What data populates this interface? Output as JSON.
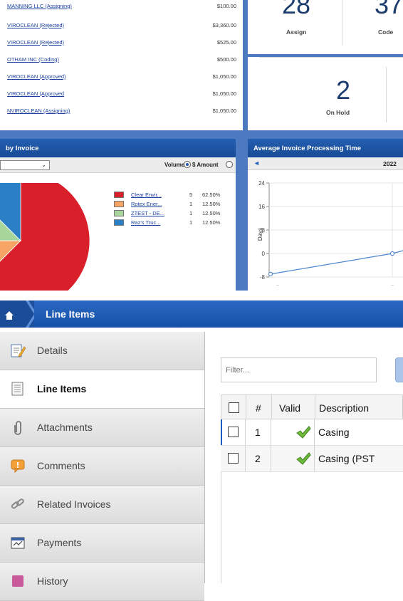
{
  "invoice_list": [
    {
      "name": "MANNING LLC (Assigning)",
      "amount": "$100.00"
    },
    {
      "name": "VIROCLEAN  (Rejected)",
      "amount": "$3,360.00"
    },
    {
      "name": "VIROCLEAN  (Rejected)",
      "amount": "$525.00"
    },
    {
      "name": "OTHAM INC (Coding)",
      "amount": "$500.00"
    },
    {
      "name": "VIROCLEAN  (Approved)",
      "amount": "$1,050.00"
    },
    {
      "name": "VIROCLEAN  (Approved",
      "amount": "$1,050.00"
    },
    {
      "name": "NVIROCLEAN  (Assigning)",
      "amount": "$1,050.00"
    }
  ],
  "stats": {
    "assign": {
      "value": "28",
      "label": "Assign"
    },
    "code": {
      "value": "37",
      "label": "Code"
    },
    "on_hold": {
      "value": "2",
      "label": "On Hold"
    }
  },
  "pie_panel": {
    "title": "by Invoice",
    "volume_label": "Volume",
    "amount_label": "$ Amount",
    "legend": [
      {
        "name": "Clear Envir...",
        "count": "5",
        "pct": "62.50%",
        "color": "#d9202a"
      },
      {
        "name": "Rotex Ener...",
        "count": "1",
        "pct": "12.50%",
        "color": "#f6a566"
      },
      {
        "name": "ZTEST - DE...",
        "count": "1",
        "pct": "12.50%",
        "color": "#a8d59a"
      },
      {
        "name": "Raz's Truc...",
        "count": "1",
        "pct": "12.50%",
        "color": "#2b80c5"
      }
    ]
  },
  "line_panel": {
    "title": "Average Invoice Processing Time",
    "year": "2022",
    "ylabel": "Days",
    "yticks": [
      "24",
      "16",
      "8",
      "0",
      "-8"
    ],
    "xticks": [
      "..",
      ".."
    ]
  },
  "chart_data": [
    {
      "type": "pie",
      "title": "by Invoice",
      "categories": [
        "Clear Envir...",
        "Rotex Ener...",
        "ZTEST - DE...",
        "Raz's Truc..."
      ],
      "values": [
        5,
        1,
        1,
        1
      ],
      "percentages": [
        62.5,
        12.5,
        12.5,
        12.5
      ],
      "colors": [
        "#d9202a",
        "#f6a566",
        "#a8d59a",
        "#2b80c5"
      ]
    },
    {
      "type": "line",
      "title": "Average Invoice Processing Time",
      "ylabel": "Days",
      "ylim": [
        -8,
        24
      ],
      "yticks": [
        24,
        16,
        8,
        0,
        -8
      ],
      "series": [
        {
          "values": [
            -7,
            0,
            1.5
          ]
        }
      ],
      "grid": true
    }
  ],
  "banner": {
    "title": "Line Items"
  },
  "nav": [
    {
      "label": "Details",
      "icon": "edit-icon"
    },
    {
      "label": "Line Items",
      "icon": "list-icon",
      "active": true
    },
    {
      "label": "Attachments",
      "icon": "paperclip-icon"
    },
    {
      "label": "Comments",
      "icon": "comment-icon"
    },
    {
      "label": "Related Invoices",
      "icon": "link-icon"
    },
    {
      "label": "Payments",
      "icon": "payment-icon"
    },
    {
      "label": "History",
      "icon": "history-icon"
    }
  ],
  "filter": {
    "placeholder": "Filter..."
  },
  "grid": {
    "headers": [
      "#",
      "Valid",
      "Description"
    ],
    "rows": [
      {
        "num": "1",
        "desc": "Casing"
      },
      {
        "num": "2",
        "desc": "Casing (PST"
      }
    ]
  }
}
